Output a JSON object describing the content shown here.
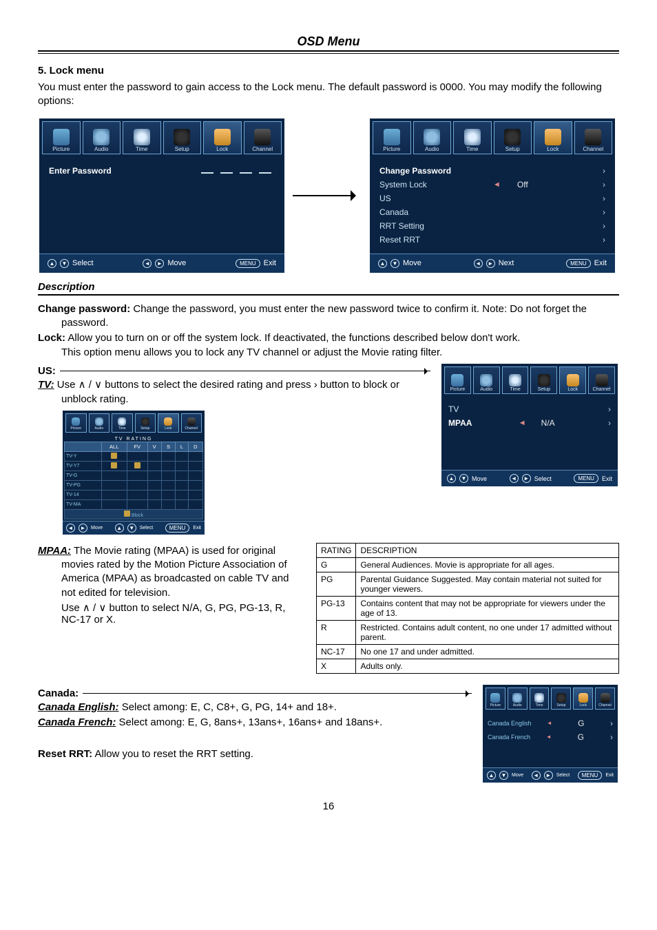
{
  "header": {
    "title": "OSD Menu"
  },
  "section5": {
    "heading": "5. Lock menu",
    "intro": "You must enter the password to gain access to the Lock menu. The default password is 0000. You may modify the following options:"
  },
  "osd_tabs": [
    "Picture",
    "Audio",
    "Time",
    "Setup",
    "Lock",
    "Channel"
  ],
  "enter_pw_screen": {
    "title": "Enter Password",
    "foot": {
      "a": "Select",
      "b": "Move",
      "c": "Exit",
      "c_btn": "MENU"
    }
  },
  "lock_menu_screen": {
    "items": [
      {
        "label": "Change Password"
      },
      {
        "label": "System Lock",
        "value": "Off",
        "selected": true
      },
      {
        "label": "US"
      },
      {
        "label": "Canada"
      },
      {
        "label": "RRT Setting"
      },
      {
        "label": "Reset RRT"
      }
    ],
    "foot": {
      "a": "Move",
      "b": "Next",
      "c": "Exit",
      "c_btn": "MENU"
    }
  },
  "description": {
    "heading": "Description",
    "change_pw_term": "Change password:",
    "change_pw_text": " Change the password, you must enter the new password twice to confirm it. Note: Do not forget the password.",
    "lock_term": "Lock:",
    "lock_text": " Allow you to turn on or off the system lock. If deactivated, the functions described below don't work.",
    "extra": "This option menu allows you to lock any TV channel or adjust the Movie rating filter."
  },
  "us": {
    "label": "US:",
    "tv_term": "TV:",
    "tv_text": " Use ∧ / ∨ buttons to select the desired rating and press › button to block or unblock rating."
  },
  "us_tv_screen": {
    "cols_hdr": "TV   RATING",
    "cols": [
      "",
      "ALL",
      "FV",
      "V",
      "S",
      "L",
      "D"
    ],
    "rows": [
      "TV-Y",
      "TV-Y7",
      "TV-G",
      "TV-PG",
      "TV-14",
      "TV-MA"
    ],
    "locks": {
      "TV-Y": [
        "ALL"
      ],
      "TV-Y7": [
        "ALL",
        "FV"
      ]
    },
    "block_hint": "Block",
    "foot": {
      "a": "Move",
      "b": "Select",
      "c": "Exit",
      "c_btn": "MENU"
    }
  },
  "us_mpaa_screen": {
    "items": [
      {
        "label": "TV"
      },
      {
        "label": "MPAA",
        "value": "N/A",
        "selected": true
      }
    ],
    "foot": {
      "a": "Move",
      "b": "Select",
      "c": "Exit",
      "c_btn": "MENU"
    }
  },
  "mpaa": {
    "term": "MPAA:",
    "text1": " The Movie rating (MPAA) is used for original movies rated by the Motion Picture Association of America (MPAA) as broadcasted on cable TV and not edited for television.",
    "text2": "Use ∧ / ∨ button to select N/A, G, PG, PG-13, R, NC-17 or X."
  },
  "rating_table": {
    "header": [
      "RATING",
      "DESCRIPTION"
    ],
    "rows": [
      [
        "G",
        "General Audiences. Movie is appropriate for all ages."
      ],
      [
        "PG",
        "Parental Guidance Suggested. May contain material not suited for younger viewers."
      ],
      [
        "PG-13",
        "Contains content that may not be appropriate for viewers under the age of 13."
      ],
      [
        "R",
        "Restricted. Contains adult content, no one under 17 admitted without parent."
      ],
      [
        "NC-17",
        "No one 17 and under admitted."
      ],
      [
        "X",
        "Adults only."
      ]
    ]
  },
  "canada": {
    "label": "Canada:",
    "en_term": "Canada English:",
    "en_text": " Select among: E, C, C8+, G, PG, 14+ and 18+.",
    "fr_term": "Canada French:",
    "fr_text": " Select among: E, G, 8ans+, 13ans+, 16ans+ and 18ans+."
  },
  "canada_screen": {
    "items": [
      {
        "label": "Canada English",
        "value": "G",
        "selected": true
      },
      {
        "label": "Canada French",
        "value": "G"
      }
    ],
    "foot": {
      "a": "Move",
      "b": "Select",
      "c": "Exit",
      "c_btn": "MENU"
    }
  },
  "reset": {
    "term": "Reset RRT:",
    "text": " Allow you to reset the RRT setting."
  },
  "page_number": "16"
}
